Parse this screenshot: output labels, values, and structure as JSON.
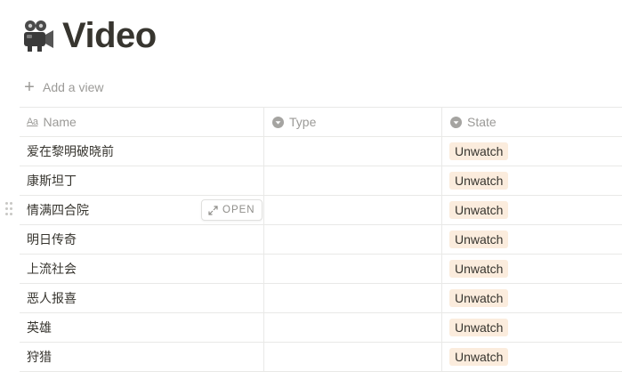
{
  "page": {
    "icon": "movie-camera-icon",
    "title": "Video"
  },
  "toolbar": {
    "add_view_icon": "plus-icon",
    "add_view_label": "Add a view"
  },
  "table": {
    "columns": [
      {
        "label": "Name",
        "icon": "text-property-icon"
      },
      {
        "label": "Type",
        "icon": "select-property-icon"
      },
      {
        "label": "State",
        "icon": "select-property-icon"
      }
    ],
    "rows": [
      {
        "name": "爱在黎明破晓前",
        "type": "",
        "state": "Unwatch"
      },
      {
        "name": "康斯坦丁",
        "type": "",
        "state": "Unwatch"
      },
      {
        "name": "情满四合院",
        "type": "",
        "state": "Unwatch"
      },
      {
        "name": "明日传奇",
        "type": "",
        "state": "Unwatch"
      },
      {
        "name": "上流社会",
        "type": "",
        "state": "Unwatch"
      },
      {
        "name": "恶人报喜",
        "type": "",
        "state": "Unwatch"
      },
      {
        "name": "英雄",
        "type": "",
        "state": "Unwatch"
      },
      {
        "name": "狩猎",
        "type": "",
        "state": "Unwatch"
      }
    ],
    "name_icon_text": "Aa",
    "open_label": "OPEN",
    "open_icon": "expand-icon",
    "hovered_row_index": 2
  },
  "colors": {
    "text": "#37352f",
    "muted": "#9b9a97",
    "border": "#e9e9e7",
    "tag_bg": "#fbecdd"
  }
}
